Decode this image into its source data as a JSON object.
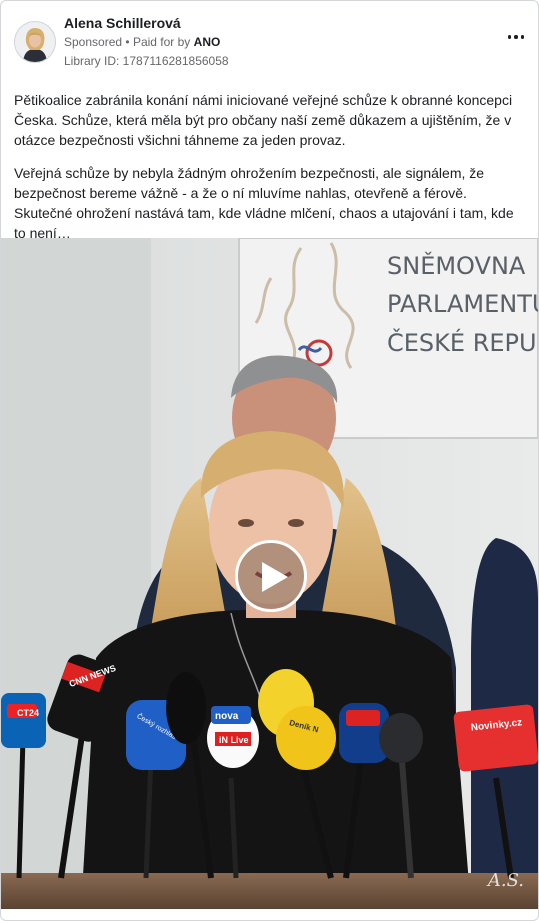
{
  "ad": {
    "advertiser_name": "Alena Schillerová",
    "sponsored_label": "Sponsored",
    "separator": "•",
    "paid_for_by_label": "Paid for by",
    "payer": "ANO",
    "library_id": "Library ID: 1787116281856058",
    "more_icon": "more-dots-icon",
    "body_paragraphs": [
      "Pětikoalice zabránila konání námi iniciované veřejné schůze k obranné koncepci Česka. Schůze, která měla být pro občany naší země důkazem a ujištěním, že v otázce bezpečnosti všichni táhneme za jeden provaz.",
      "Veřejná schůze by nebyla žádným ohrožením bezpečnosti, ale signálem, že bezpečnost bereme vážně - a že o ní mluvíme nahlas, otevřeně a férově. Skutečné ohrožení nastává tam, kde vládne mlčení, chaos a utajování i tam, kde to není…"
    ]
  },
  "video": {
    "sign_lines": [
      "SNĚMOVNA",
      "PARLAMENTU",
      "ČESKÉ REPUBLIKY"
    ],
    "mic_labels": [
      "CNN NEWS",
      "Český rozhlas",
      "nova",
      "Deník N",
      "CT24",
      "Novinky.cz",
      "iN Live"
    ],
    "watermark": "A.S.",
    "play_icon": "play-icon"
  },
  "colors": {
    "text_primary": "#1c1e21",
    "text_secondary": "#65676b",
    "border": "#d4d6da"
  }
}
